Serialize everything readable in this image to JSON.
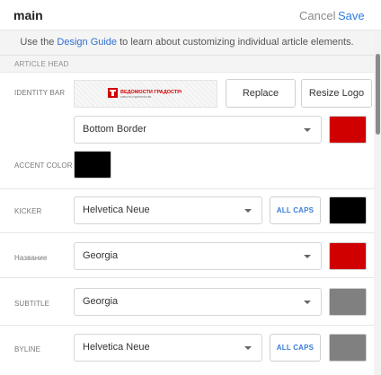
{
  "header": {
    "title": "main",
    "cancel": "Cancel",
    "save": "Save"
  },
  "guide": {
    "prefix": "Use the ",
    "link": "Design Guide",
    "suffix": " to learn about customizing individual article elements."
  },
  "section": "ARTICLE HEAD",
  "identity_bar": {
    "label": "IDENTITY BAR",
    "logo_text": "ВЕДОМОСТИ ГРАДОСТРОИТЕЛЯ",
    "replace": "Replace",
    "resize": "Resize Logo",
    "border_select": "Bottom Border",
    "border_color": "#d10000"
  },
  "accent_color": {
    "label": "ACCENT COLOR",
    "color": "#000000"
  },
  "kicker": {
    "label": "KICKER",
    "font": "Helvetica Neue",
    "caps": "ALL CAPS",
    "color": "#000000"
  },
  "nazvanie": {
    "label": "Название",
    "font": "Georgia",
    "color": "#d10000"
  },
  "subtitle": {
    "label": "SUBTITLE",
    "font": "Georgia",
    "color": "#808080"
  },
  "byline": {
    "label": "BYLINE",
    "font": "Helvetica Neue",
    "caps": "ALL CAPS",
    "color": "#808080"
  },
  "colors": {
    "link": "#2f7ee0",
    "brand_red": "#d10000"
  }
}
